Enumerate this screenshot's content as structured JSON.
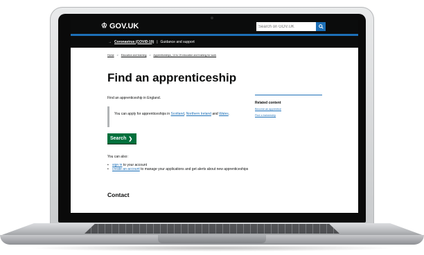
{
  "header": {
    "logo_text": "GOV.UK",
    "search_placeholder": "Search on GOV.UK"
  },
  "covid_banner": {
    "arrow": "→",
    "link_text": "Coronavirus (COVID-19)",
    "separator": "|",
    "guidance_text": "Guidance and support"
  },
  "breadcrumb": {
    "items": [
      "Home",
      "Education and learning",
      "Apprenticeships, 14 to 19 education and training for work"
    ],
    "separator": ">"
  },
  "main": {
    "title": "Find an apprenticeship",
    "intro": "Find an apprenticeship in England.",
    "inset_prefix": "You can apply for apprenticeships in ",
    "inset_link_1": "Scotland",
    "inset_comma": ", ",
    "inset_link_2": "Northern Ireland",
    "inset_and": " and ",
    "inset_link_3": "Wales",
    "inset_suffix": ".",
    "start_button_label": "Search",
    "also_label": "You can also:",
    "also_items": [
      {
        "link": "sign in",
        "rest": " to your account"
      },
      {
        "link": "create an account",
        "rest": " to manage your applications and get alerts about new apprenticeships"
      }
    ],
    "contact_heading": "Contact"
  },
  "related": {
    "title": "Related content",
    "links": [
      "Become an apprentice",
      "Find a traineeship"
    ]
  },
  "colors": {
    "header_black": "#0b0c0c",
    "gov_blue": "#1d70b8",
    "start_green": "#00703c"
  }
}
